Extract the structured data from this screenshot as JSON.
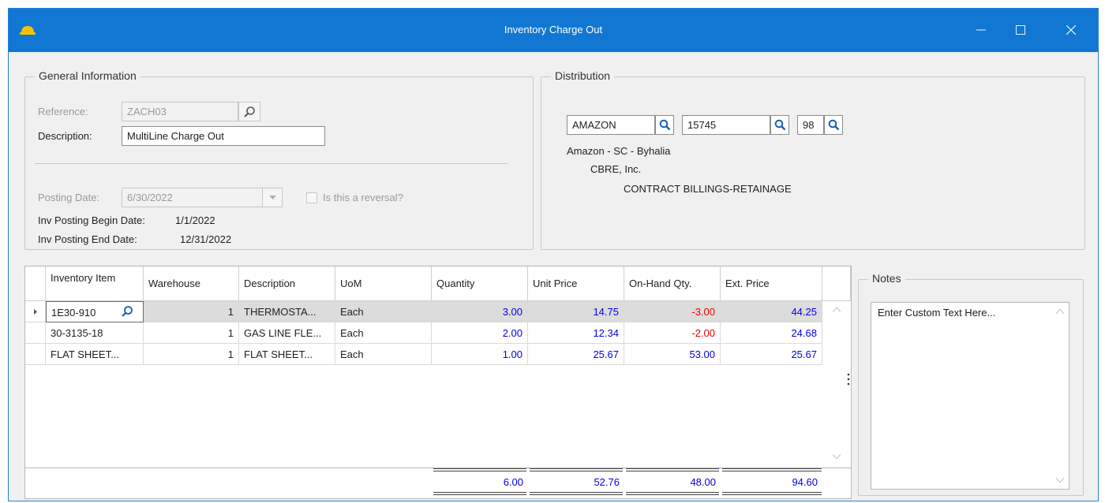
{
  "window": {
    "title": "Inventory Charge Out",
    "icon": "hard-hat-icon",
    "controls": [
      "minimize-icon",
      "maximize-icon",
      "close-icon"
    ]
  },
  "general": {
    "title": "General Information",
    "reference_label": "Reference:",
    "reference_value": "ZACH03",
    "description_label": "Description:",
    "description_value": "MultiLine Charge Out",
    "posting_date_label": "Posting Date:",
    "posting_date_value": "6/30/2022",
    "reversal_label": "Is this a reversal?",
    "reversal_checked": false,
    "begin_label": "Inv Posting Begin Date:",
    "begin_value": "1/1/2022",
    "end_label": "Inv Posting End Date:",
    "end_value": "12/31/2022"
  },
  "distribution": {
    "title": "Distribution",
    "field1": "AMAZON",
    "field2": "15745",
    "field3": "98",
    "line1": "Amazon - SC - Byhalia",
    "line2": "CBRE, Inc.",
    "line3": "CONTRACT BILLINGS-RETAINAGE"
  },
  "grid": {
    "headers": {
      "item": "Inventory Item",
      "warehouse": "Warehouse",
      "description": "Description",
      "uom": "UoM",
      "quantity": "Quantity",
      "unit_price": "Unit Price",
      "onhand": "On-Hand Qty.",
      "ext_price": "Ext. Price"
    },
    "rows": [
      {
        "item": "1E30-910",
        "warehouse": "1",
        "description": "THERMOSTA...",
        "uom": "Each",
        "quantity": "3.00",
        "unit_price": "14.75",
        "onhand": "-3.00",
        "ext_price": "44.25"
      },
      {
        "item": "30-3135-18",
        "warehouse": "1",
        "description": "GAS LINE FLE...",
        "uom": "Each",
        "quantity": "2.00",
        "unit_price": "12.34",
        "onhand": "-2.00",
        "ext_price": "24.68"
      },
      {
        "item": "FLAT SHEET...",
        "warehouse": "1",
        "description": "FLAT SHEET...",
        "uom": "Each",
        "quantity": "1.00",
        "unit_price": "25.67",
        "onhand": "53.00",
        "ext_price": "25.67"
      }
    ],
    "totals": {
      "quantity": "6.00",
      "unit_price": "52.76",
      "onhand": "48.00",
      "ext_price": "94.60"
    }
  },
  "notes": {
    "title": "Notes",
    "text": "Enter Custom Text Here..."
  },
  "colors": {
    "titlebar": "#1177d2",
    "number_blue": "#0000ee",
    "negative_red": "#e60000",
    "search_blue": "#1a5fb4"
  }
}
